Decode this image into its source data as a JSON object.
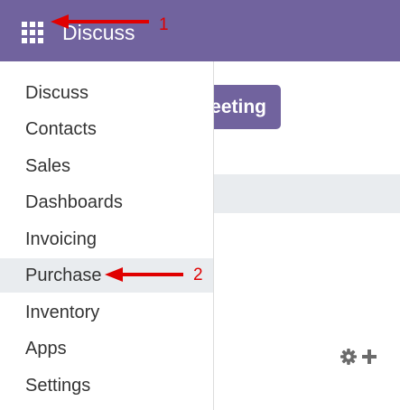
{
  "navbar": {
    "title": "Discuss",
    "apps_icon": "grid-icon",
    "color": "#71639e"
  },
  "main": {
    "button_label": "eeting",
    "tools": [
      "gear-icon",
      "plus-icon"
    ]
  },
  "apps_menu": {
    "items": [
      {
        "label": "Discuss"
      },
      {
        "label": "Contacts"
      },
      {
        "label": "Sales"
      },
      {
        "label": "Dashboards"
      },
      {
        "label": "Invoicing"
      },
      {
        "label": "Purchase",
        "highlighted": true
      },
      {
        "label": "Inventory"
      },
      {
        "label": "Apps"
      },
      {
        "label": "Settings"
      }
    ]
  },
  "annotations": [
    {
      "number": "1",
      "color": "#e00000"
    },
    {
      "number": "2",
      "color": "#e00000"
    }
  ]
}
